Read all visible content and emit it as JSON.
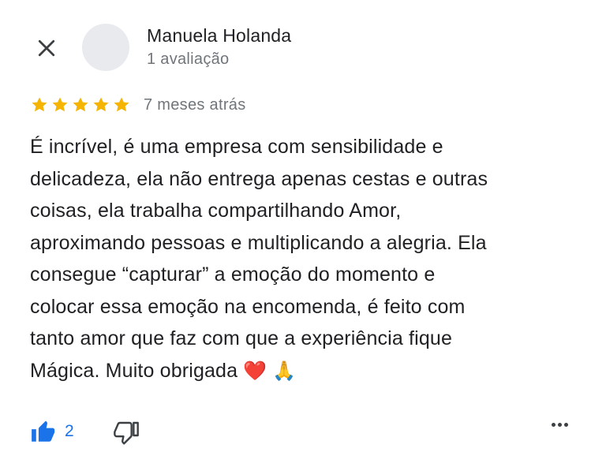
{
  "author": {
    "name": "Manuela Holanda",
    "review_count": "1 avaliação"
  },
  "review": {
    "rating": 5,
    "rating_max": 5,
    "time": "7 meses atrás",
    "text": "É incrível, é uma empresa com sensibilidade e\ndelicadeza, ela não entrega apenas cestas e outras\ncoisas, ela trabalha compartilhando Amor,\naproximando pessoas e multiplicando a alegria. Ela\nconsegue “capturar” a emoção do momento e\ncolocar essa emoção na encomenda, é feito com\ntanto amor que faz com que a experiência fique\nMágica. Muito obrigada",
    "emojis": "❤️ 🙏"
  },
  "actions": {
    "like_count": "2"
  },
  "colors": {
    "star": "#f4b400",
    "like": "#1a73e8",
    "secondary_text": "#70757a"
  },
  "icons": {
    "close": "close-icon",
    "like": "thumbs-up-icon",
    "dislike": "thumbs-down-icon",
    "more": "more-horizontal-icon"
  }
}
